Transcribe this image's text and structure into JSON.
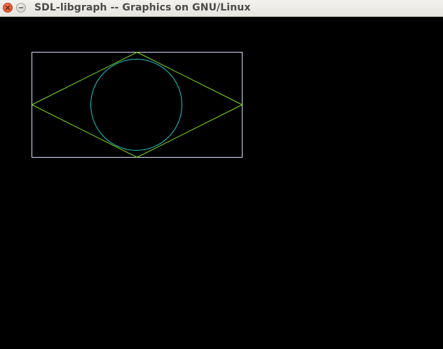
{
  "window": {
    "title": "SDL-libgraph -- Graphics on GNU/Linux",
    "close_icon": "close-icon",
    "minimize_icon": "minimize-icon"
  },
  "canvas": {
    "background": "#000000",
    "rectangle_color": "#d8dcf8",
    "diamond_color": "#7ee81c",
    "circle_color": "#20c8c8"
  }
}
